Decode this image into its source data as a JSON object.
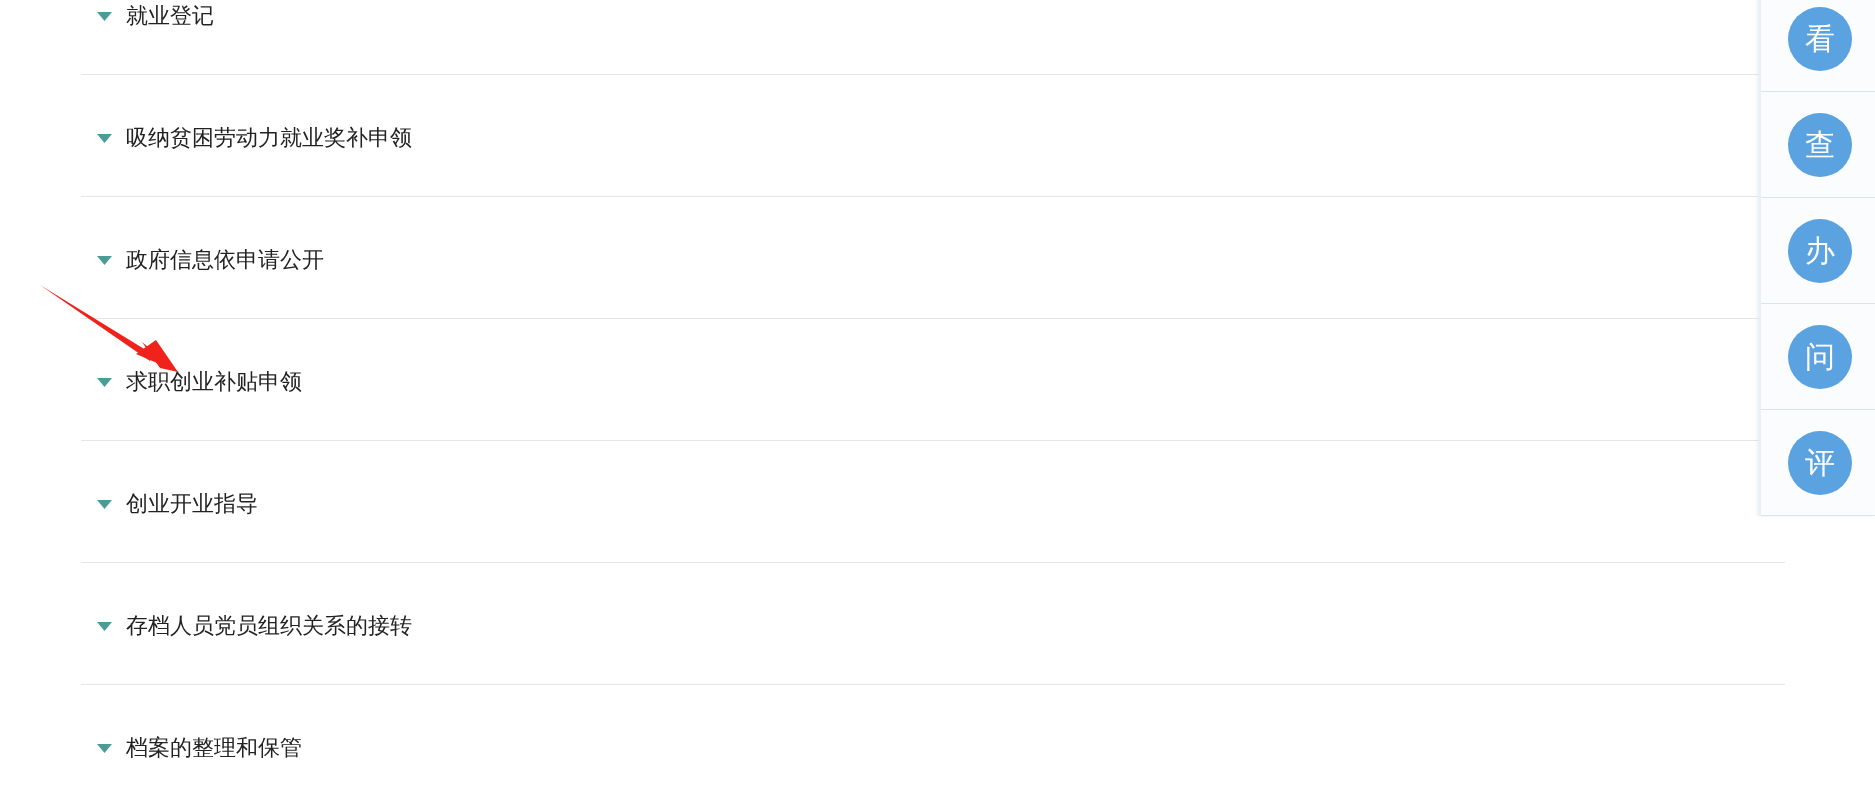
{
  "services": [
    {
      "label": "就业登记"
    },
    {
      "label": "吸纳贫困劳动力就业奖补申领"
    },
    {
      "label": "政府信息依申请公开"
    },
    {
      "label": "求职创业补贴申领"
    },
    {
      "label": "创业开业指导"
    },
    {
      "label": "存档人员党员组织关系的接转"
    },
    {
      "label": "档案的整理和保管"
    }
  ],
  "quick_links": [
    {
      "label": "看"
    },
    {
      "label": "查"
    },
    {
      "label": "办"
    },
    {
      "label": "问"
    },
    {
      "label": "评"
    }
  ]
}
